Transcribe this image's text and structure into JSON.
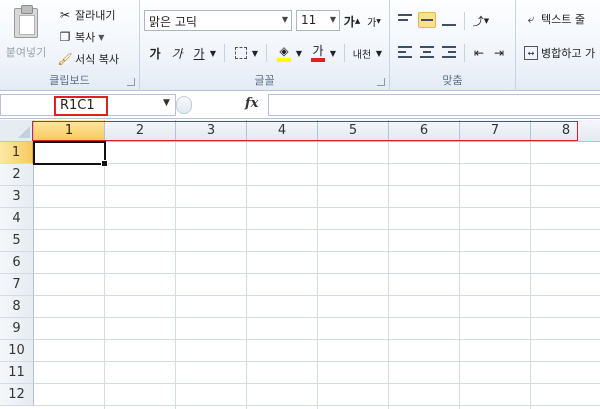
{
  "ribbon": {
    "clipboard": {
      "paste_label": "붙여넣기",
      "cut_label": "잘라내기",
      "copy_label": "복사",
      "format_painter_label": "서식 복사",
      "group_label": "클립보드"
    },
    "font": {
      "font_name": "맑은 고딕",
      "font_size": "11",
      "grow_label": "가",
      "shrink_label": "가",
      "bold_label": "가",
      "italic_label": "가",
      "underline_label": "가",
      "font_color_label": "가",
      "phonetic_label": "내천",
      "group_label": "글꼴"
    },
    "alignment": {
      "group_label": "맞춤"
    },
    "wrap": {
      "wrap_text_label": "텍스트 줄",
      "merge_label": "병합하고 가"
    }
  },
  "formula_bar": {
    "name_box_value": "R1C1",
    "fx_label": "fx",
    "formula_value": ""
  },
  "grid": {
    "columns": [
      "1",
      "2",
      "3",
      "4",
      "5",
      "6",
      "7",
      "8"
    ],
    "rows": [
      "1",
      "2",
      "3",
      "4",
      "5",
      "6",
      "7",
      "8",
      "9",
      "10",
      "11",
      "12"
    ],
    "active_cell": "R1C1"
  },
  "colors": {
    "highlight_red": "#e02020",
    "active_header": "#f9c861",
    "gridline": "#d4dbe5"
  }
}
